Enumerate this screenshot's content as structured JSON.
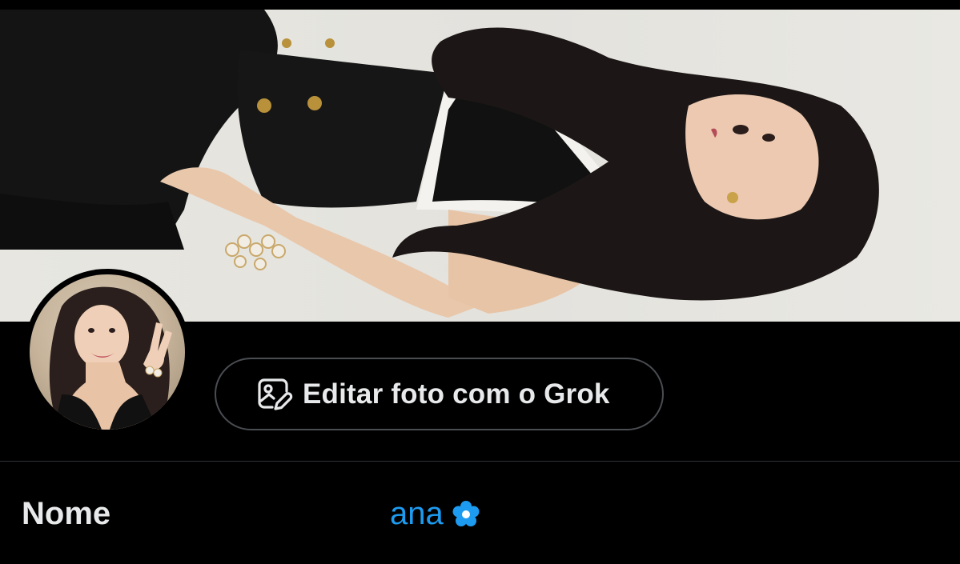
{
  "header": {
    "image": "header-photo",
    "description_icon": "header-image"
  },
  "profile": {
    "avatar_icon": "avatar-photo",
    "grok_button": {
      "icon": "image-edit-icon",
      "label": "Editar foto com o Grok"
    }
  },
  "fields": {
    "name": {
      "label": "Nome",
      "value": "ana",
      "emoji_icon": "flower-icon"
    }
  },
  "colors": {
    "background": "#000000",
    "text": "#e7e9ea",
    "accent": "#1d9bf0",
    "border": "#4a4d52",
    "divider": "#2f3336"
  }
}
